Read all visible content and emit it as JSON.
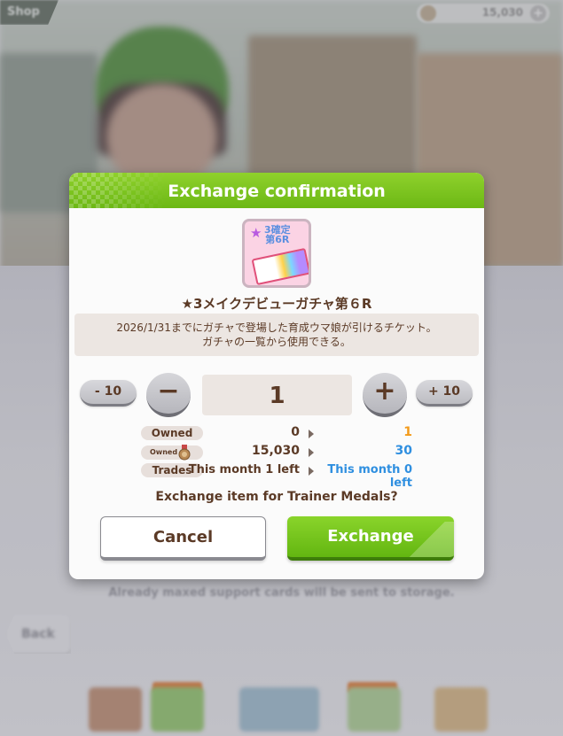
{
  "background": {
    "screen_label": "Shop",
    "currency_value": "15,030",
    "note": "Already maxed support cards will be sent to storage.",
    "back_label": "Back"
  },
  "dialog": {
    "title": "Exchange confirmation",
    "item": {
      "icon": "ticket-icon",
      "badge_line1": "3確定",
      "badge_line2": "第6R",
      "name": "★3メイクデビューガチャ第６R",
      "description_line1": "2026/1/31までにガチャで登場した育成ウマ娘が引けるチケット。",
      "description_line2": "ガチャの一覧から使用できる。"
    },
    "quantity": {
      "minus10_label": "- 10",
      "minus_label": "−",
      "value": "1",
      "plus_label": "+",
      "plus10_label": "+ 10"
    },
    "stats": {
      "owned_label": "Owned",
      "owned_current": "0",
      "owned_after": "1",
      "medal_label": "Owned",
      "medal_current": "15,030",
      "medal_after": "30",
      "trades_label": "Trades",
      "trades_current": "This month 1 left",
      "trades_after": "This month 0 left"
    },
    "question": "Exchange item for Trainer Medals?",
    "cancel_label": "Cancel",
    "exchange_label": "Exchange"
  },
  "colors": {
    "accent_green": "#6cb815",
    "owned_after_orange": "#f39a1a",
    "blue_after": "#2f8fe0",
    "text_brown": "#5b3a26"
  }
}
